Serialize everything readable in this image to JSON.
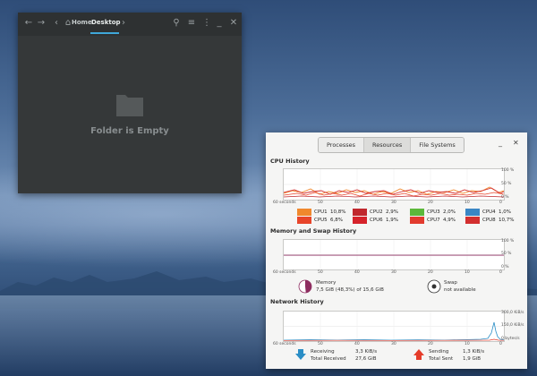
{
  "file_manager": {
    "breadcrumbs": [
      "Home",
      "Desktop"
    ],
    "empty_message": "Folder is Empty"
  },
  "system_monitor": {
    "tabs": [
      "Processes",
      "Resources",
      "File Systems"
    ],
    "selected_tab": "Resources",
    "cpu": {
      "title": "CPU History",
      "x_ticks": [
        "60 seconds",
        "50",
        "40",
        "30",
        "20",
        "10",
        "0"
      ],
      "y_ticks": [
        "100 %",
        "50 %",
        "0 %"
      ],
      "cores": [
        {
          "label": "CPU1",
          "value": "10,8%",
          "color": "#f0882d"
        },
        {
          "label": "CPU2",
          "value": "2,9%",
          "color": "#c0282d"
        },
        {
          "label": "CPU3",
          "value": "2,0%",
          "color": "#5cb83a"
        },
        {
          "label": "CPU4",
          "value": "1,0%",
          "color": "#3a86c4"
        },
        {
          "label": "CPU5",
          "value": "6,8%",
          "color": "#e8452a"
        },
        {
          "label": "CPU6",
          "value": "1,9%",
          "color": "#d6232b"
        },
        {
          "label": "CPU7",
          "value": "4,9%",
          "color": "#e23b2e"
        },
        {
          "label": "CPU8",
          "value": "10,7%",
          "color": "#d32f2f"
        }
      ]
    },
    "memory": {
      "title": "Memory and Swap History",
      "x_ticks": [
        "60 seconds",
        "50",
        "40",
        "30",
        "20",
        "10",
        "0"
      ],
      "y_ticks": [
        "100 %",
        "50 %",
        "0 %"
      ],
      "memory_label": "Memory",
      "memory_value": "7,5 GiB (48,3%) of 15,6 GiB",
      "memory_fraction": 0.483,
      "swap_label": "Swap",
      "swap_value": "not available",
      "memory_color": "#8e2d60"
    },
    "network": {
      "title": "Network History",
      "x_ticks": [
        "60 seconds",
        "50",
        "40",
        "30",
        "20",
        "10",
        "0"
      ],
      "y_ticks": [
        "300,0 KiB/s",
        "150,0 KiB/s",
        "0 bytes/s"
      ],
      "receiving_label": "Receiving",
      "receiving_value": "3,3 KiB/s",
      "total_received_label": "Total Received",
      "total_received_value": "27,6 GiB",
      "sending_label": "Sending",
      "sending_value": "1,3 KiB/s",
      "total_sent_label": "Total Sent",
      "total_sent_value": "1,9 GiB",
      "receive_color": "#2b8ec6",
      "send_color": "#e53c2a"
    }
  }
}
